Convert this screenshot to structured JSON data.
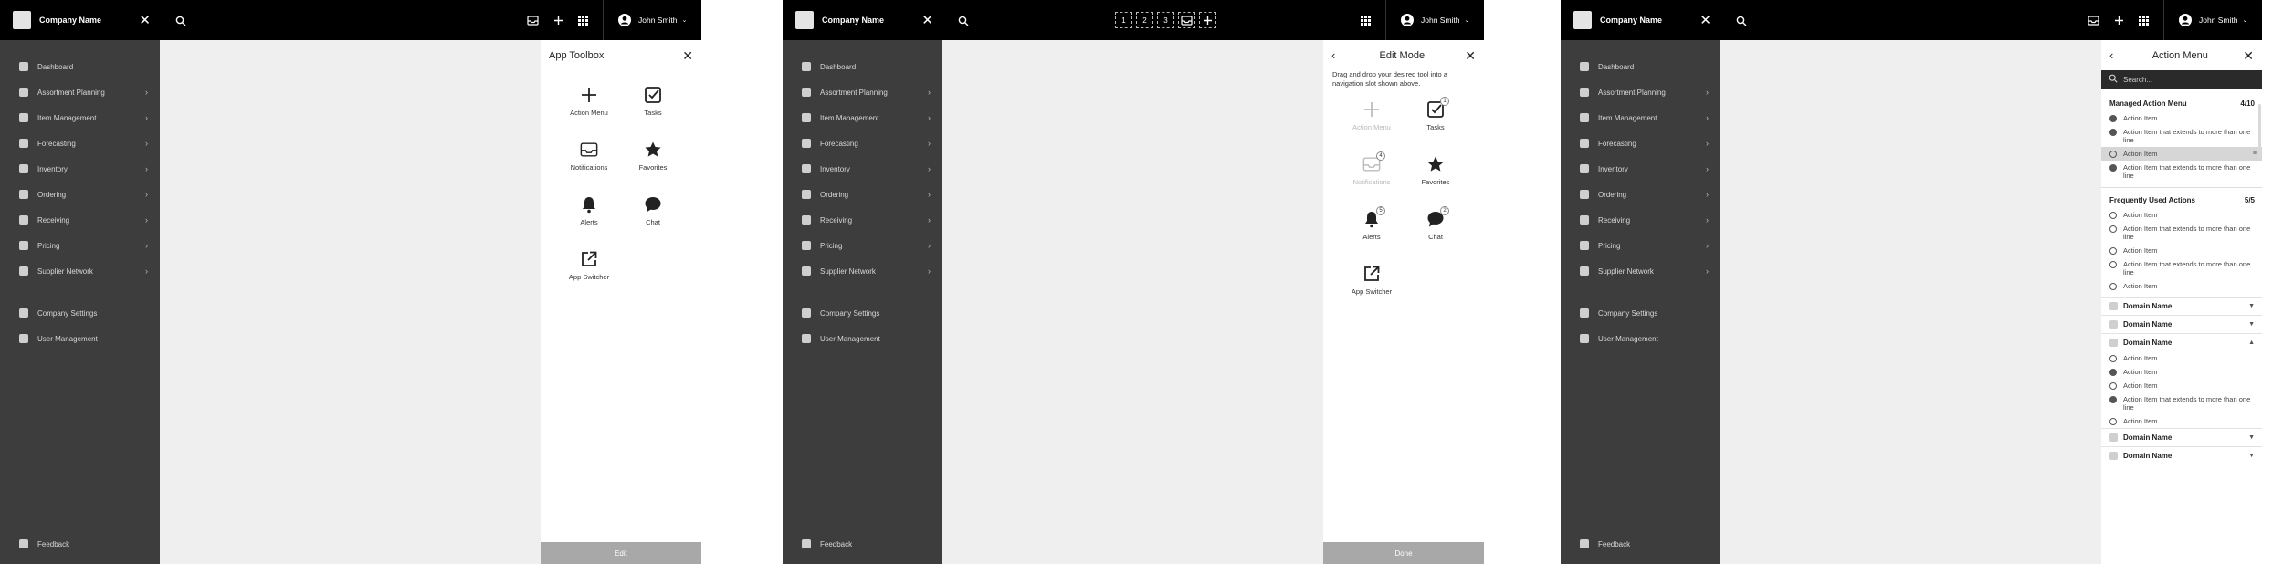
{
  "company_name": "Company Name",
  "user_name": "John Smith",
  "nav_items": [
    {
      "label": "Dashboard",
      "chevron": false
    },
    {
      "label": "Assortment Planning",
      "chevron": true
    },
    {
      "label": "Item Management",
      "chevron": true
    },
    {
      "label": "Forecasting",
      "chevron": true
    },
    {
      "label": "Inventory",
      "chevron": true
    },
    {
      "label": "Ordering",
      "chevron": true
    },
    {
      "label": "Receiving",
      "chevron": true
    },
    {
      "label": "Pricing",
      "chevron": true
    },
    {
      "label": "Supplier Network",
      "chevron": true
    }
  ],
  "settings_items": [
    "Company Settings",
    "User Management"
  ],
  "feedback_label": "Feedback",
  "toolbox": {
    "title": "App Toolbox",
    "tools": [
      "Action Menu",
      "Tasks",
      "Notifications",
      "Favorites",
      "Alerts",
      "Chat",
      "App Switcher"
    ],
    "footer_label": "Edit"
  },
  "edit_mode": {
    "title": "Edit Mode",
    "hint": "Drag and drop your desired tool into a navigation slot shown above.",
    "slots": [
      "1",
      "2",
      "3"
    ],
    "badges": {
      "tasks": "1",
      "notifications": "4",
      "alerts": "5",
      "chat": "2"
    },
    "footer_label": "Done"
  },
  "action_menu": {
    "title": "Action Menu",
    "search_placeholder": "Search...",
    "managed": {
      "title": "Managed Action Menu",
      "count": "4/10",
      "items": [
        {
          "label": "Action Item",
          "filled": true,
          "selected": false
        },
        {
          "label": "Action Item that extends to more than one line",
          "filled": true,
          "selected": false
        },
        {
          "label": "Action Item",
          "filled": false,
          "selected": true
        },
        {
          "label": "Action Item that extends to more than one line",
          "filled": true,
          "selected": false
        }
      ]
    },
    "frequent": {
      "title": "Frequently Used Actions",
      "count": "5/5",
      "items": [
        {
          "label": "Action Item",
          "filled": false
        },
        {
          "label": "Action Item that extends to more than one line",
          "filled": false
        },
        {
          "label": "Action Item",
          "filled": false
        },
        {
          "label": "Action Item that extends to more than one line",
          "filled": false
        },
        {
          "label": "Action Item",
          "filled": false
        }
      ]
    },
    "domains": [
      {
        "label": "Domain Name",
        "expanded": false
      },
      {
        "label": "Domain Name",
        "expanded": false
      },
      {
        "label": "Domain Name",
        "expanded": true,
        "items": [
          {
            "label": "Action Item",
            "filled": false
          },
          {
            "label": "Action Item",
            "filled": true
          },
          {
            "label": "Action Item",
            "filled": false
          },
          {
            "label": "Action Item that extends to more than one line",
            "filled": true
          },
          {
            "label": "Action Item",
            "filled": false
          }
        ]
      },
      {
        "label": "Domain Name",
        "expanded": false
      },
      {
        "label": "Domain Name",
        "expanded": false
      }
    ]
  }
}
